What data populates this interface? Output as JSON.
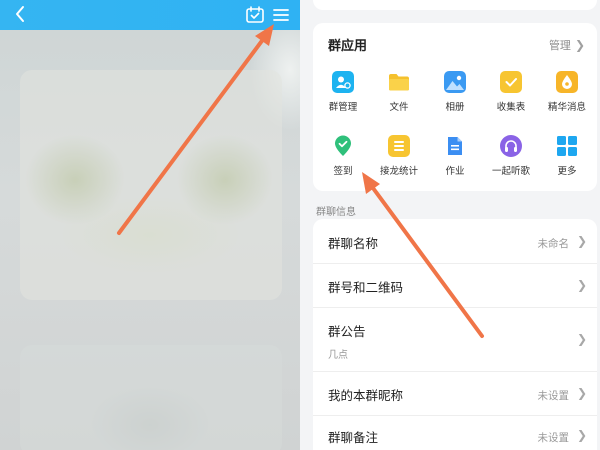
{
  "left_panel": {
    "icons": {
      "back": "back-chevron-icon",
      "calendar": "calendar-check-icon",
      "menu": "hamburger-menu-icon"
    }
  },
  "group_apps": {
    "title": "群应用",
    "manage_label": "管理",
    "items": [
      {
        "label": "群管理",
        "icon": "group-manage-icon",
        "color": "#1db3f0"
      },
      {
        "label": "文件",
        "icon": "folder-icon",
        "color": "#f5c12d"
      },
      {
        "label": "相册",
        "icon": "photo-album-icon",
        "color": "#3b9af2"
      },
      {
        "label": "收集表",
        "icon": "collection-form-icon",
        "color": "#f7c531"
      },
      {
        "label": "精华消息",
        "icon": "essence-drop-icon",
        "color": "#f7b529"
      },
      {
        "label": "签到",
        "icon": "checkin-location-icon",
        "color": "#2fc07b"
      },
      {
        "label": "接龙统计",
        "icon": "relay-list-icon",
        "color": "#f7c531"
      },
      {
        "label": "作业",
        "icon": "homework-document-icon",
        "color": "#3b8ef2"
      },
      {
        "label": "一起听歌",
        "icon": "headphones-icon",
        "color": "#8a63e6"
      },
      {
        "label": "更多",
        "icon": "more-grid-icon",
        "color": "#1ea7f0"
      }
    ]
  },
  "group_info": {
    "section_label": "群聊信息",
    "rows": [
      {
        "title": "群聊名称",
        "value": "未命名"
      },
      {
        "title": "群号和二维码",
        "value": ""
      },
      {
        "title": "群公告",
        "value": "",
        "subtitle": "几点"
      },
      {
        "title": "我的本群昵称",
        "value": "未设置"
      },
      {
        "title": "群聊备注",
        "value": "未设置"
      }
    ]
  },
  "colors": {
    "accent_blue": "#33b4f2",
    "annotation_arrow": "#f07548"
  }
}
